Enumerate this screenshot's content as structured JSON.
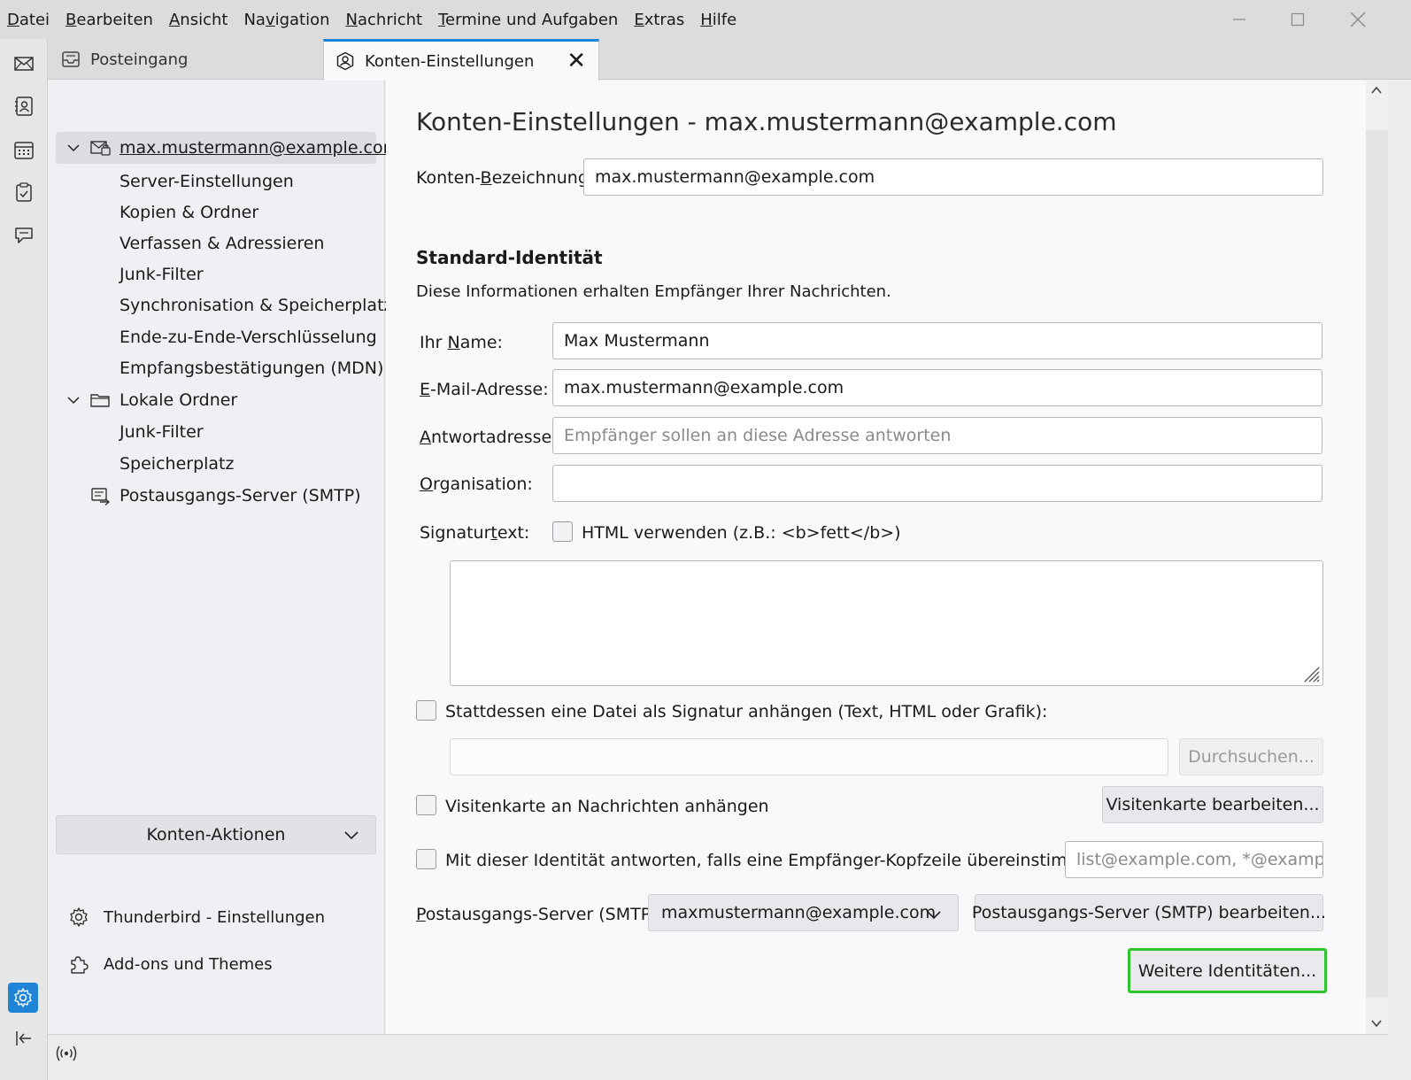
{
  "menubar": {
    "items": [
      {
        "label": "Datei",
        "u": "D",
        "rest": "atei"
      },
      {
        "label": "Bearbeiten",
        "u": "B",
        "rest": "earbeiten"
      },
      {
        "label": "Ansicht",
        "u": "A",
        "rest": "nsicht"
      },
      {
        "label": "Navigation",
        "pre": "Na",
        "u": "v",
        "rest": "igation"
      },
      {
        "label": "Nachricht",
        "u": "N",
        "rest": "achricht"
      },
      {
        "label": "Termine und Aufgaben",
        "u": "T",
        "rest": "ermine und Aufgaben"
      },
      {
        "label": "Extras",
        "u": "E",
        "rest": "xtras"
      },
      {
        "label": "Hilfe",
        "u": "H",
        "rest": "ilfe"
      }
    ]
  },
  "tabs": {
    "inbox": "Posteingang",
    "settings": "Konten-Einstellungen",
    "close": "✕"
  },
  "tree": {
    "account": "max.mustermann@example.com",
    "account_items": [
      "Server-Einstellungen",
      "Kopien & Ordner",
      "Verfassen & Adressieren",
      "Junk-Filter",
      "Synchronisation & Speicherplatz",
      "Ende-zu-Ende-Verschlüsselung",
      "Empfangsbestätigungen (MDN)"
    ],
    "local": "Lokale Ordner",
    "local_items": [
      "Junk-Filter",
      "Speicherplatz"
    ],
    "smtp": "Postausgangs-Server (SMTP)",
    "actions": "Konten-Aktionen",
    "settings_link": "Thunderbird - Einstellungen",
    "addons_link": "Add-ons und Themes"
  },
  "main": {
    "title": "Konten-Einstellungen - max.mustermann@example.com",
    "account_name_label": "Konten-Bezeichnung:",
    "account_name_value": "max.mustermann@example.com",
    "identity_heading": "Standard-Identität",
    "identity_desc": "Diese Informationen erhalten Empfänger Ihrer Nachrichten.",
    "name_label": "Ihr Name:",
    "name_value": "Max Mustermann",
    "email_label": "E-Mail-Adresse:",
    "email_value": "max.mustermann@example.com",
    "reply_label": "Antwortadresse:",
    "reply_placeholder": "Empfänger sollen an diese Adresse antworten",
    "org_label": "Organisation:",
    "org_value": "",
    "sig_label": "Signaturtext:",
    "html_checkbox_label": "HTML verwenden (z.B.: <b>fett</b>)",
    "sig_file_label": "Stattdessen eine Datei als Signatur anhängen (Text, HTML oder Grafik):",
    "browse": "Durchsuchen...",
    "vcard_label": "Visitenkarte an Nachrichten anhängen",
    "vcard_button": "Visitenkarte bearbeiten...",
    "catch_label": "Mit dieser Identität antworten, falls eine Empfänger-Kopfzeile übereinstimmt mit:",
    "catch_placeholder": "list@example.com, *@example.com",
    "smtp_label": "Postausgangs-Server (SMTP):",
    "smtp_value": "maxmustermann@example.com",
    "smtp_button": "Postausgangs-Server (SMTP) bearbeiten...",
    "more_identities": "Weitere Identitäten..."
  },
  "colors": {
    "accent": "#1f83d6",
    "focus_ring": "#2ec52e",
    "settings_space": "#1f83d6"
  }
}
